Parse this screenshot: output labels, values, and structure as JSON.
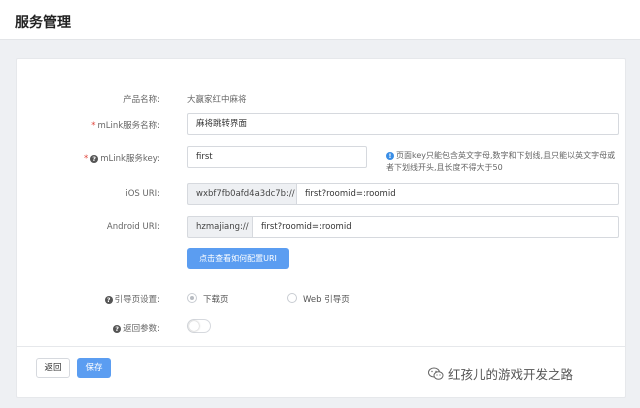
{
  "header": {
    "title": "服务管理"
  },
  "form": {
    "product_name": {
      "label": "产品名称:",
      "value": "大赢家红中麻将"
    },
    "service_name": {
      "required": "*",
      "label": "mLink服务名称:",
      "value": "麻将跳转界面"
    },
    "service_key": {
      "required": "*",
      "help_icon": "question-circle-icon",
      "label": "mLink服务key:",
      "value": "first",
      "hint": "页面key只能包含英文字母,数字和下划线,且只能以英文字母或者下划线开头,且长度不得大于50",
      "hint_icon": "info-circle-icon"
    },
    "ios_uri": {
      "label": "iOS URI:",
      "prefix": "wxbf7fb0afd4a3dc7b://",
      "value": "first?roomid=:roomid"
    },
    "android_uri": {
      "label": "Android URI:",
      "prefix": "hzmajiang://",
      "value": "first?roomid=:roomid"
    },
    "config_button": "点击查看如何配置URI",
    "guide_page": {
      "help_icon": "question-circle-icon",
      "label": "引导页设置:",
      "options": [
        "下载页",
        "Web 引导页"
      ],
      "selected": "下载页"
    },
    "return_param": {
      "help_icon": "question-circle-icon",
      "label": "返回参数:",
      "enabled": false
    }
  },
  "actions": {
    "back": "返回",
    "save": "保存"
  },
  "watermark": {
    "icon": "wechat-icon",
    "text": "红孩儿的游戏开发之路"
  },
  "colors": {
    "primary": "#5b9df1",
    "required": "#e0443a",
    "info": "#3a8ee6"
  }
}
